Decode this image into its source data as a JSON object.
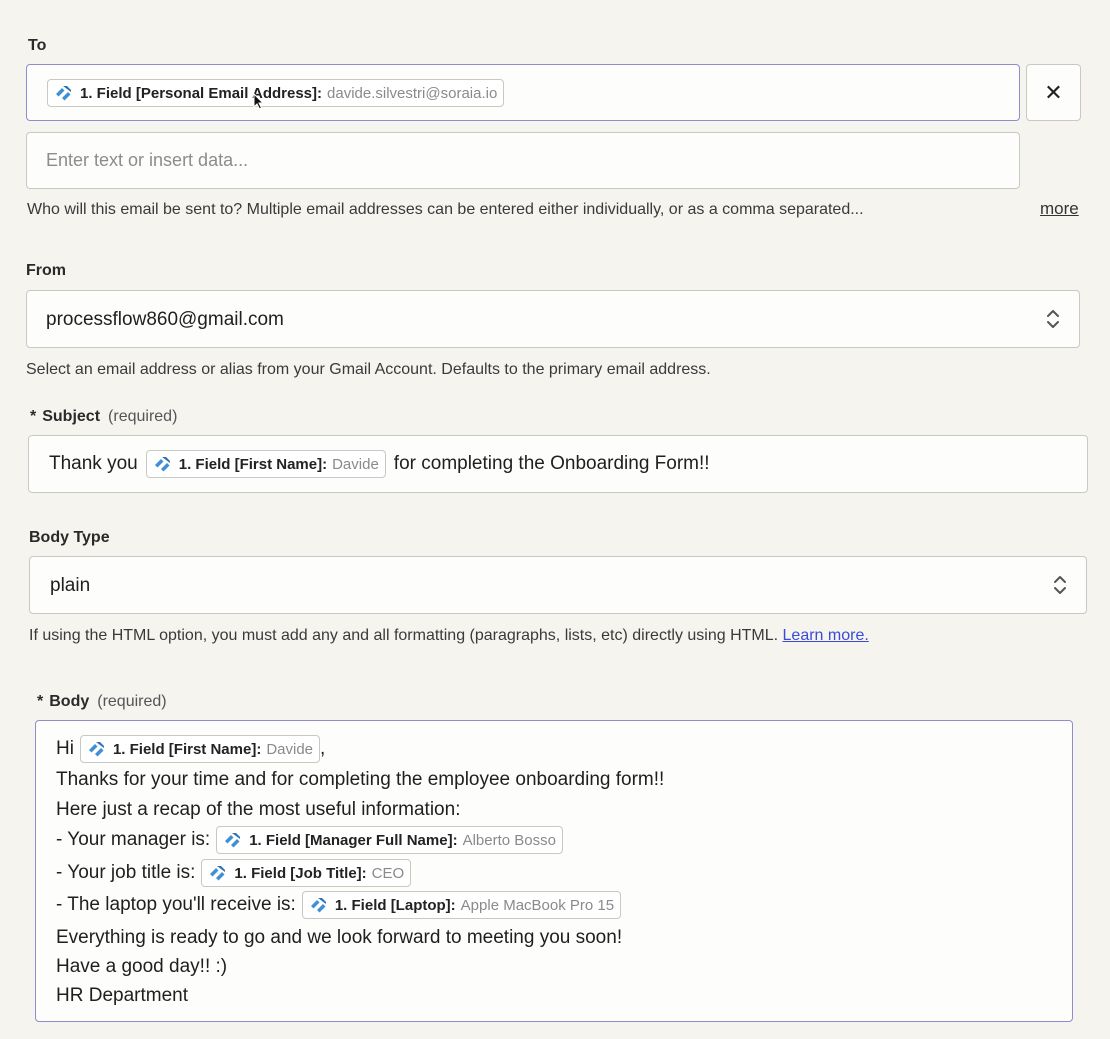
{
  "to": {
    "label": "To",
    "pill_name": "1. Field [Personal Email Address]:",
    "pill_value": "davide.silvestri@soraia.io",
    "remove_icon": "close-icon",
    "remove_glyph": "✕",
    "second_input_placeholder": "Enter text or insert data...",
    "hint": "Who will this email be sent to? Multiple email addresses can be entered either individually, or as a comma separated...",
    "more_label": "more"
  },
  "from": {
    "label": "From",
    "value": "processflow860@gmail.com",
    "hint": "Select an email address or alias from your Gmail Account. Defaults to the primary email address."
  },
  "subject": {
    "star": "*",
    "label": "Subject",
    "required": "(required)",
    "prefix": "Thank you",
    "pill_name": "1. Field [First Name]:",
    "pill_value": "Davide",
    "suffix": "for completing the Onboarding Form!!"
  },
  "body_type": {
    "label": "Body Type",
    "value": "plain",
    "hint": "If using the HTML option, you must add any and all formatting (paragraphs, lists, etc) directly using HTML.",
    "learn_more": "Learn more."
  },
  "body": {
    "star": "*",
    "label": "Body",
    "required": "(required)",
    "line1_prefix": "Hi",
    "line1_pill_name": "1. Field [First Name]:",
    "line1_pill_value": "Davide",
    "line1_suffix": ",",
    "line2": "Thanks for your time and for completing the employee onboarding form!!",
    "line3": "Here just a recap of the most useful information:",
    "line4_prefix": "- Your manager is:",
    "line4_pill_name": "1. Field [Manager Full Name]:",
    "line4_pill_value": "Alberto Bosso",
    "line5_prefix": "- Your job title is:",
    "line5_pill_name": "1. Field [Job Title]:",
    "line5_pill_value": "CEO",
    "line6_prefix": "- The laptop you'll receive is:",
    "line6_pill_name": "1. Field [Laptop]:",
    "line6_pill_value": "Apple MacBook Pro 15",
    "line7": "Everything is ready to go and we look forward to meeting you soon!",
    "line8": "Have a good day!! :)",
    "line9": "HR Department"
  },
  "icons": {
    "field_icon": "zapier-field-icon",
    "select_icon": "chevron-up-down-icon"
  },
  "colors": {
    "field_icon": "#3f8fd6",
    "link": "#3b4bd8",
    "focus_border": "#8f8ccf"
  }
}
